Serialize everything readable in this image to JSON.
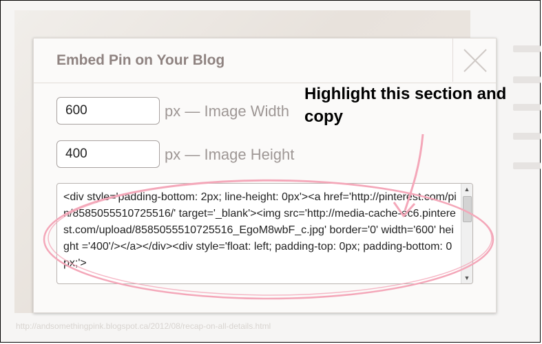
{
  "dialog": {
    "title": "Embed Pin on Your Blog",
    "close_icon": "close-icon"
  },
  "width_field": {
    "value": "600",
    "label": "px — Image Width"
  },
  "height_field": {
    "value": "400",
    "label": "px — Image Height"
  },
  "embed_code": {
    "text": "<div style='padding-bottom: 2px; line-height: 0px'><a href='http://pinterest.com/pin/8585055510725516/' target='_blank'><img src='http://media-cache-ec6.pinterest.com/upload/8585055510725516_EgoM8wbF_c.jpg' border='0' width='600' height ='400'/></a></div><div style='float: left; padding-top: 0px; padding-bottom: 0px;'>",
    "scroll_up_icon": "triangle-up-icon",
    "scroll_down_icon": "triangle-down-icon"
  },
  "annotation": {
    "text": "Highlight this section and copy",
    "color": "#f4a7b9"
  },
  "background": {
    "url_text": "http://andsomethingpink.blogspot.ca/2012/08/recap-on-all-details.html"
  }
}
